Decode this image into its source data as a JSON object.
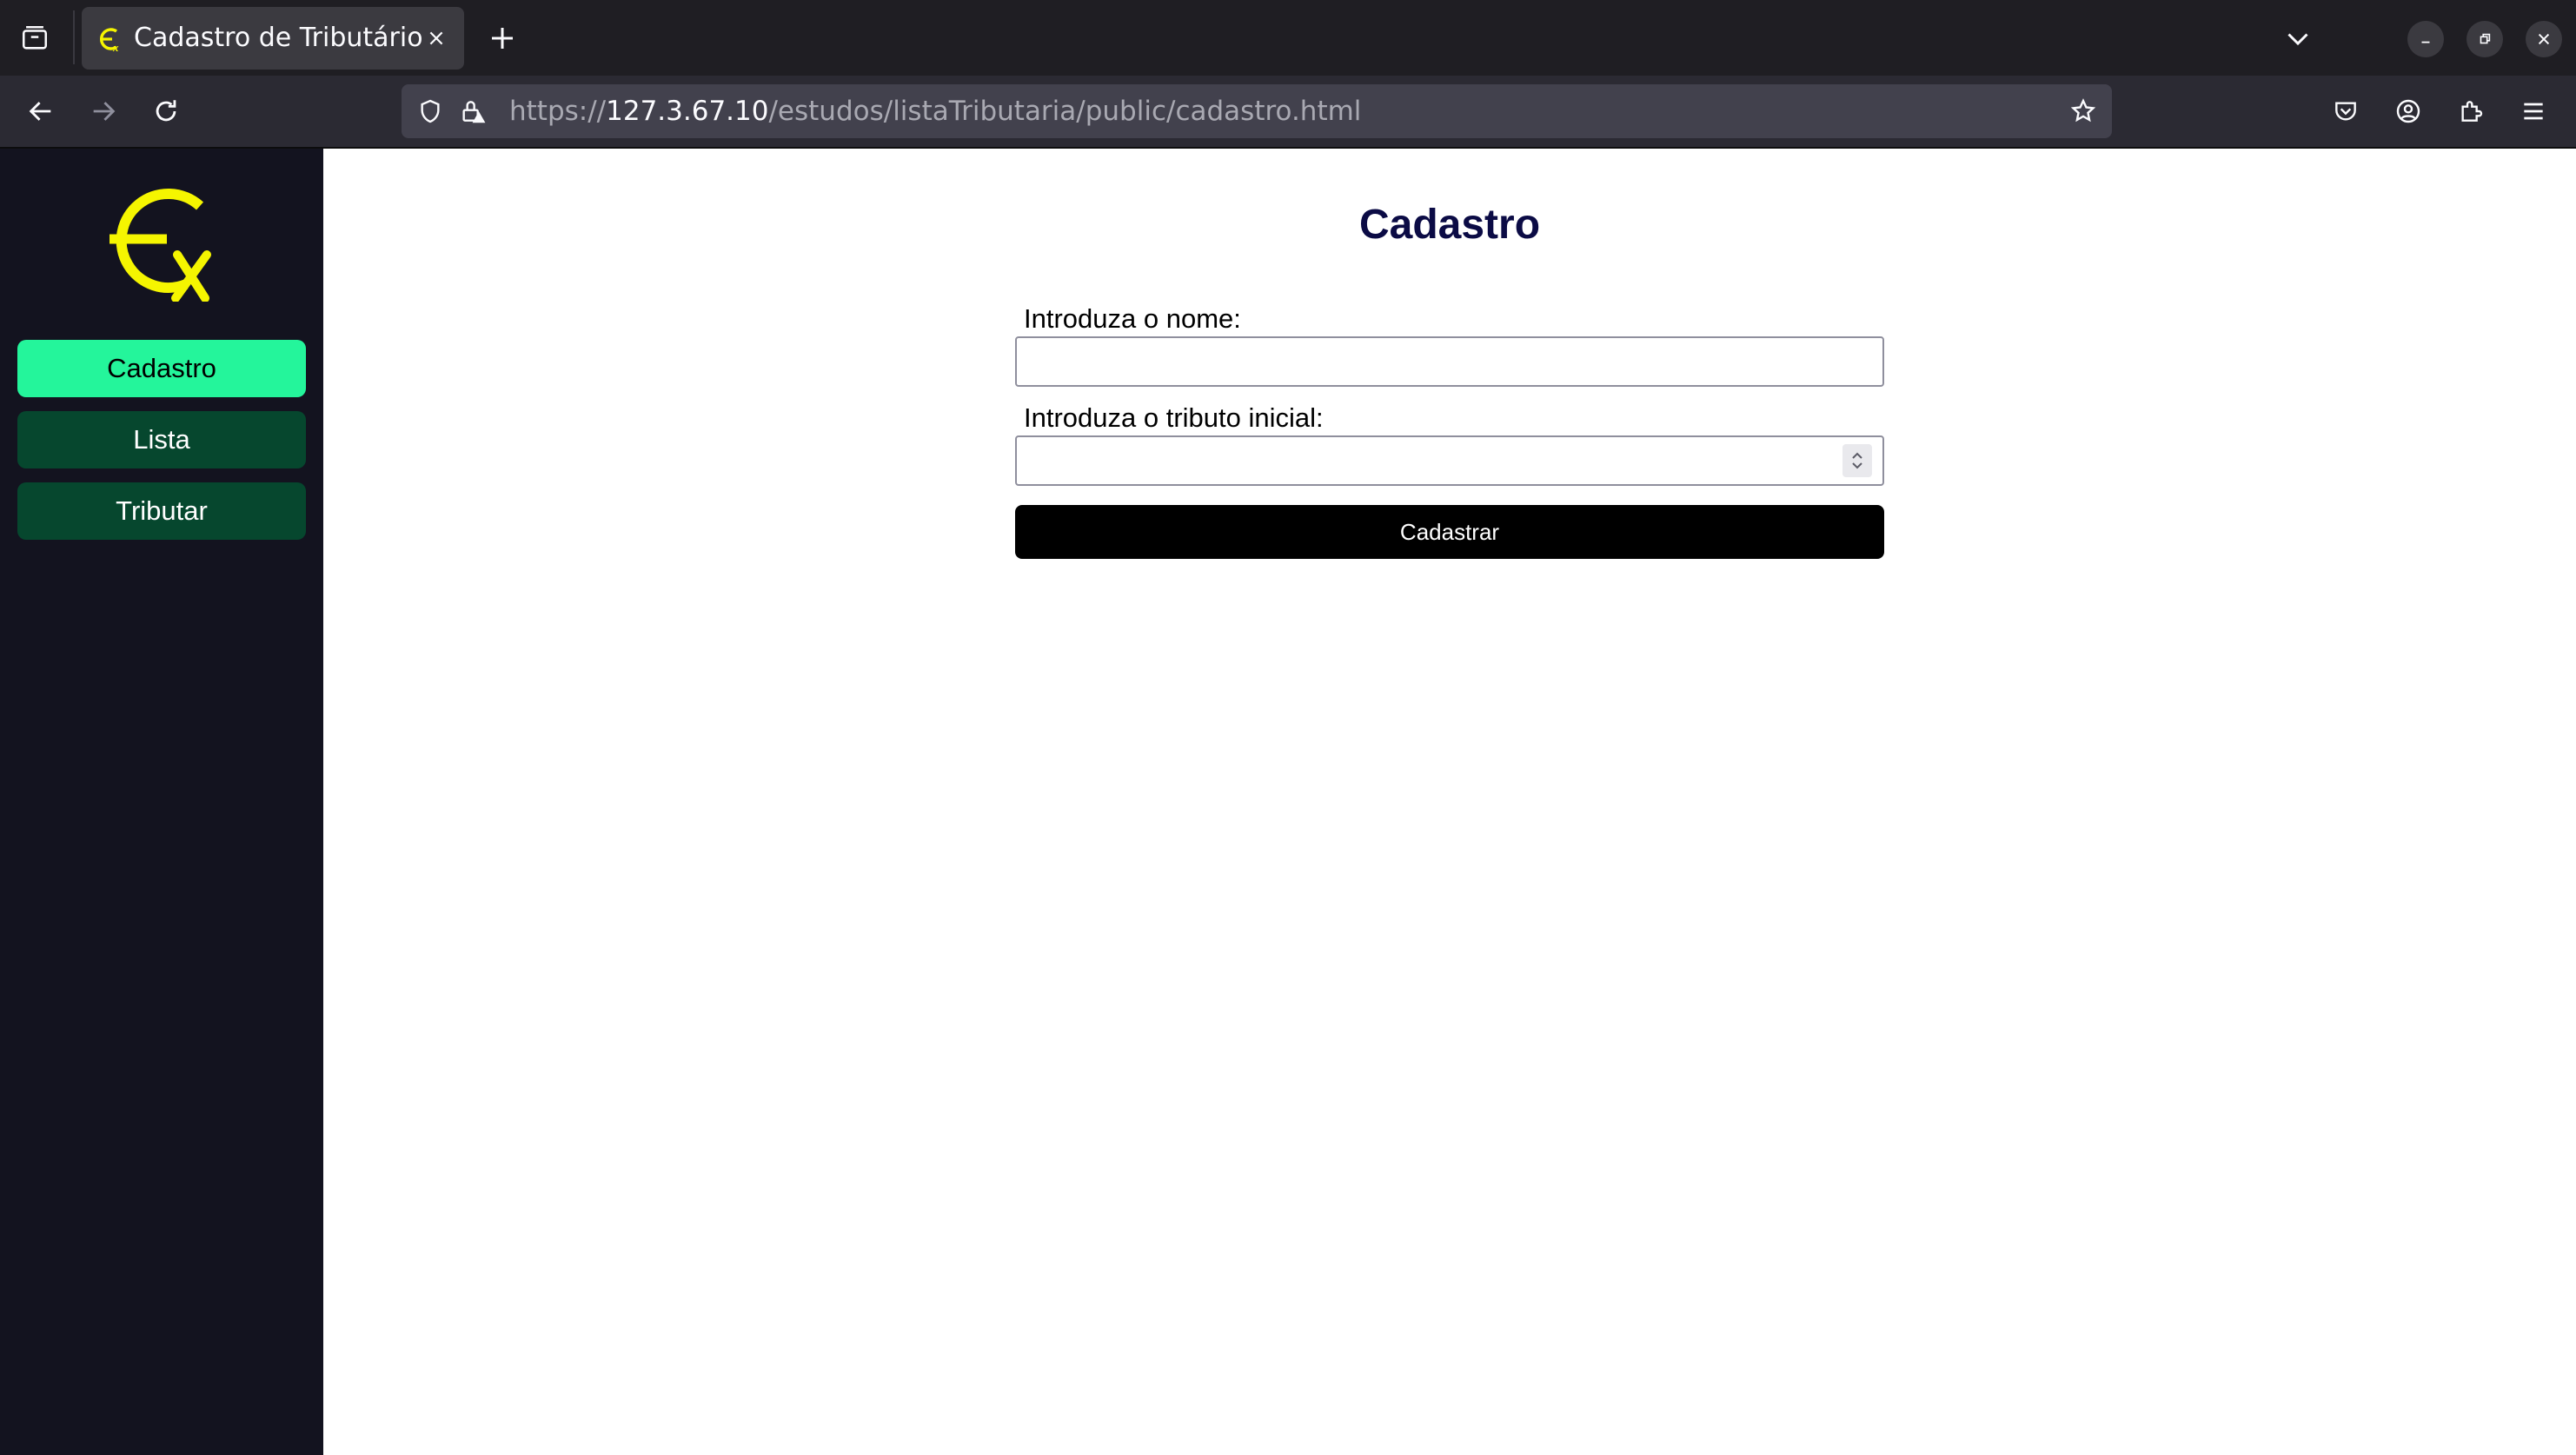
{
  "browser": {
    "tab": {
      "title": "Cadastro de Tributário",
      "favicon": "ex-logo-icon"
    },
    "url": {
      "scheme": "https://",
      "host": "127.3.67.10",
      "path": "/estudos/listaTributaria/public/cadastro.html"
    }
  },
  "sidebar": {
    "logo": "ex-logo",
    "items": [
      {
        "label": "Cadastro",
        "active": true
      },
      {
        "label": "Lista",
        "active": false
      },
      {
        "label": "Tributar",
        "active": false
      }
    ]
  },
  "main": {
    "title": "Cadastro",
    "form": {
      "name_label": "Introduza o nome:",
      "name_value": "",
      "tribute_label": "Introduza o tributo inicial:",
      "tribute_value": "",
      "submit_label": "Cadastrar"
    }
  },
  "colors": {
    "sidebar_bg": "#13131f",
    "nav_active": "#24f59b",
    "nav_inactive": "#06472e",
    "title": "#0b0b45",
    "logo": "#f5f500",
    "button": "#000000"
  }
}
